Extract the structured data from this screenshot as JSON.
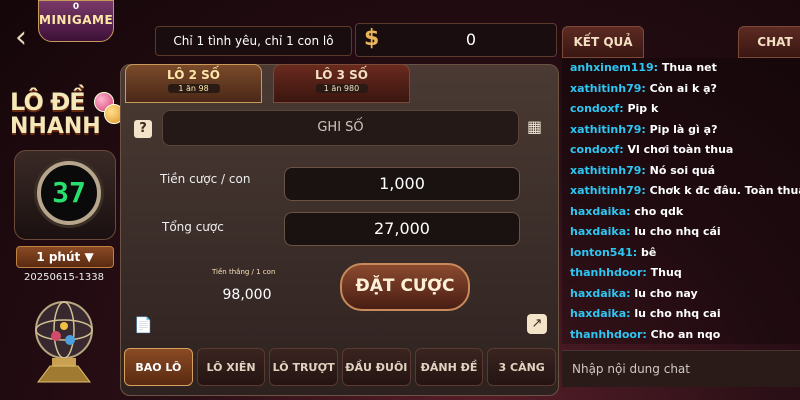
{
  "topbar": {
    "minigame": {
      "count": "0",
      "label": "MINIGAME"
    },
    "slogan": "Chỉ 1 tình yêu, chỉ 1 con lô",
    "balance": "0",
    "tab_result": "KẾT QUẢ",
    "tab_chat": "CHAT"
  },
  "left": {
    "logo_line1": "LÔ ĐỀ",
    "logo_line2": "NHANH",
    "countdown": "37",
    "period": "1 phút",
    "draw_id": "20250615-1338"
  },
  "bet_tabs": [
    {
      "label": "LÔ 2 SỐ",
      "sub": "1 ăn 98"
    },
    {
      "label": "LÔ 3 SỐ",
      "sub": "1 ăn 980"
    }
  ],
  "form": {
    "note_placeholder": "GHI SỐ",
    "amount_label": "Tiền cược / con",
    "amount_value": "1,000",
    "total_label": "Tổng cược",
    "total_value": "27,000",
    "win_label": "Tiền thắng / 1 con",
    "win_value": "98,000",
    "bet_button": "ĐẶT CƯỢC"
  },
  "bottom_tabs": [
    "BAO LÔ",
    "LÔ XIÊN",
    "LÔ TRƯỢT",
    "ĐẦU ĐUÔI",
    "ĐÁNH ĐỀ",
    "3 CÀNG"
  ],
  "chat": {
    "messages": [
      {
        "user": "anhxinem119:",
        "text": "Thua net"
      },
      {
        "user": "xathitinh79:",
        "text": "Còn ai k ạ?"
      },
      {
        "user": "condoxf:",
        "text": "Pip k"
      },
      {
        "user": "xathitinh79:",
        "text": "Pip là gì ạ?"
      },
      {
        "user": "condoxf:",
        "text": "Vl chơi toàn thua"
      },
      {
        "user": "xathitinh79:",
        "text": "Nó soi quá"
      },
      {
        "user": "xathitinh79:",
        "text": "Chơk k đc đâu. Toàn thua"
      },
      {
        "user": "haxdaika:",
        "text": "cho qdk"
      },
      {
        "user": "haxdaika:",
        "text": "lu cho nhq cái"
      },
      {
        "user": "lonton541:",
        "text": "bê"
      },
      {
        "user": "thanhhdoor:",
        "text": "Thuq"
      },
      {
        "user": "haxdaika:",
        "text": "lu cho nay"
      },
      {
        "user": "haxdaika:",
        "text": "lu cho nhq cai"
      },
      {
        "user": "thanhhdoor:",
        "text": "Cho an nqo"
      }
    ],
    "input_placeholder": "Nhập nội dung chat"
  },
  "colors": {
    "accent": "#e9b45a",
    "chat_user": "#2ec7f3",
    "countdown": "#29e06e"
  }
}
